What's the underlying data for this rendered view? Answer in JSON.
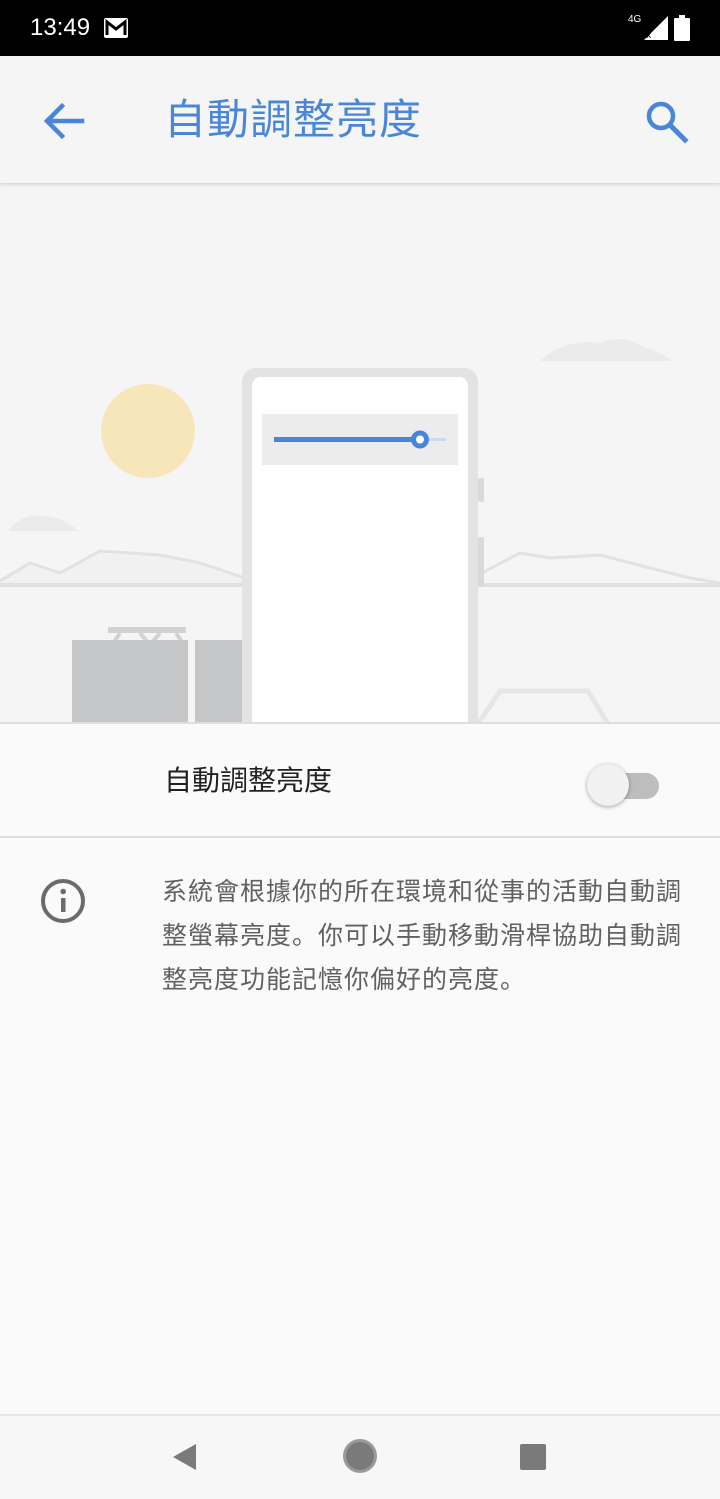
{
  "status_bar": {
    "time": "13:49",
    "network": "4G",
    "icons": [
      "gmail-icon",
      "signal-icon",
      "battery-icon"
    ]
  },
  "app_bar": {
    "title": "自動調整亮度",
    "back_icon": "arrow-back-icon",
    "search_icon": "search-icon"
  },
  "hero": {
    "illustration": "phone-with-brightness-slider-outdoor-scene",
    "slider_level": 0.85
  },
  "setting": {
    "label": "自動調整亮度",
    "toggle_on": false
  },
  "info": {
    "icon": "info-icon",
    "text": "系統會根據你的所在環境和從事的活動自動調整螢幕亮度。你可以手動移動滑桿協助自動調整亮度功能記憶你偏好的亮度。"
  },
  "nav_bar": {
    "icons": [
      "nav-back-icon",
      "nav-home-icon",
      "nav-recents-icon"
    ]
  },
  "colors": {
    "accent": "#4a86d8",
    "status_bar": "#000000",
    "background": "#fafafa",
    "sun": "#f7e6b9"
  }
}
